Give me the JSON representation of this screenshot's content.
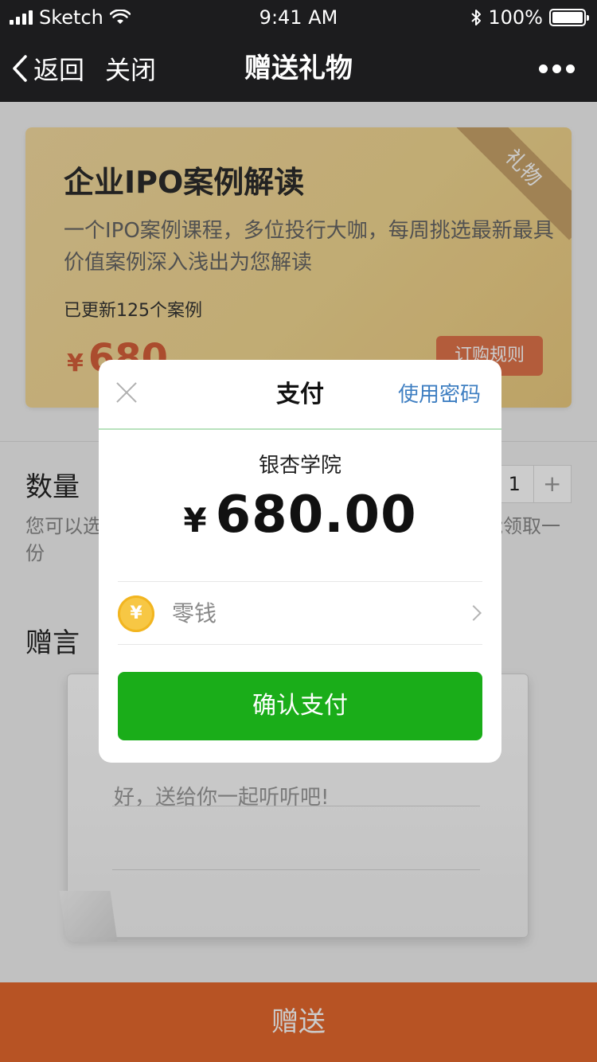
{
  "status_bar": {
    "carrier": "Sketch",
    "time": "9:41 AM",
    "battery": "100%",
    "bluetooth_icon": "bluetooth-icon",
    "wifi_icon": "wifi-icon"
  },
  "nav": {
    "back_label": "返回",
    "close_label": "关闭",
    "title": "赠送礼物"
  },
  "course": {
    "title": "企业IPO案例解读",
    "description": "一个IPO案例课程，多位投行大咖，每周挑选最新最具价值案例深入浅出为您解读",
    "update": "已更新125个案例",
    "price_symbol": "¥",
    "price": "680",
    "ribbon": "礼物",
    "rules_label": "订购规则"
  },
  "quantity": {
    "label": "数量",
    "value": "1",
    "hint": "您可以选择赠送数量，购买后好友可领取，每个用户只能领取一份"
  },
  "message": {
    "label": "赠言",
    "text": "好，送给你一起听听吧!"
  },
  "bottom": {
    "send_label": "赠送"
  },
  "payment": {
    "title": "支付",
    "use_password": "使用密码",
    "merchant": "银杏学院",
    "currency": "¥",
    "amount": "680.00",
    "method": "零钱",
    "coin_symbol": "¥",
    "confirm_label": "确认支付"
  },
  "colors": {
    "accent": "#e5682d",
    "pay_green": "#1aad19",
    "link_blue": "#3f7fc2"
  }
}
